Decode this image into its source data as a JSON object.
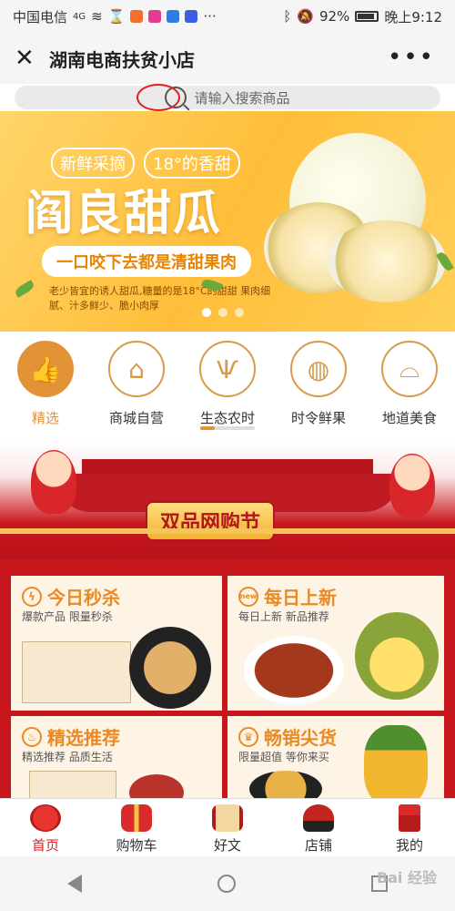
{
  "status_bar": {
    "carrier": "中国电信",
    "network": "4G",
    "battery": "92%",
    "time": "晚上9:12"
  },
  "title_bar": {
    "title": "湖南电商扶贫小店",
    "more": "•••"
  },
  "search": {
    "placeholder": "请输入搜索商品"
  },
  "banner": {
    "tags": [
      "新鲜采摘",
      "18°的香甜"
    ],
    "title": "阎良甜瓜",
    "slogan": "一口咬下去都是清甜果肉",
    "description": "老少皆宜的诱人甜瓜,糖量的是18°C的甜甜 果肉细腻、汁多鲜少、脆小肉厚",
    "dots": 3,
    "active_dot": 0
  },
  "categories": [
    {
      "label": "精选",
      "icon": "thumbs-up-icon",
      "glyph": "👍",
      "selected": true
    },
    {
      "label": "商城自营",
      "icon": "store-icon",
      "glyph": "⌂",
      "selected": false
    },
    {
      "label": "生态农时",
      "icon": "plant-icon",
      "glyph": "Ѱ",
      "selected": false
    },
    {
      "label": "时令鲜果",
      "icon": "apple-icon",
      "glyph": "◍",
      "selected": false
    },
    {
      "label": "地道美食",
      "icon": "cloche-icon",
      "glyph": "⌓",
      "selected": false
    }
  ],
  "festival": {
    "title": "双品网购节"
  },
  "tiles": [
    {
      "title": "今日秒杀",
      "subtitle": "爆款产品  限量秒杀",
      "icon": "lightning-icon",
      "glyph": "ϟ"
    },
    {
      "title": "每日上新",
      "subtitle": "每日上新  新品推荐",
      "icon": "new-badge-icon",
      "glyph": "new"
    },
    {
      "title": "精选推荐",
      "subtitle": "精选推荐  品质生活",
      "icon": "flame-icon",
      "glyph": "♨"
    },
    {
      "title": "畅销尖货",
      "subtitle": "限量超值  等你来买",
      "icon": "crown-icon",
      "glyph": "♛"
    }
  ],
  "bottom_nav": [
    {
      "label": "首页",
      "icon": "lantern-icon",
      "active": true
    },
    {
      "label": "购物车",
      "icon": "gift-icon",
      "active": false
    },
    {
      "label": "好文",
      "icon": "scroll-icon",
      "active": false
    },
    {
      "label": "店铺",
      "icon": "store-hat-icon",
      "active": false
    },
    {
      "label": "我的",
      "icon": "red-envelope-icon",
      "active": false
    }
  ],
  "watermark": "Bai 经验",
  "colors": {
    "accent": "#e29338",
    "festival_red": "#c8161d",
    "nav_active": "#dd2222"
  }
}
